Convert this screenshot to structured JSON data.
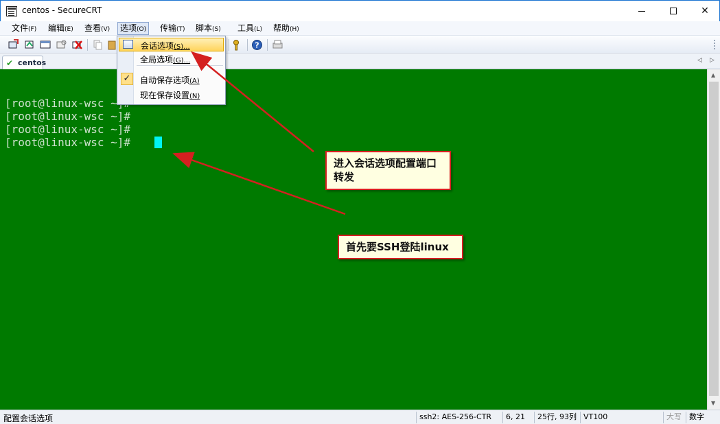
{
  "window": {
    "title": "centos - SecureCRT"
  },
  "menu": [
    {
      "label": "文件",
      "acc": "(F)"
    },
    {
      "label": "编辑",
      "acc": "(E)"
    },
    {
      "label": "查看",
      "acc": "(V)"
    },
    {
      "label": "选项",
      "acc": "(O)"
    },
    {
      "label": "传输",
      "acc": "(T)"
    },
    {
      "label": "脚本",
      "acc": "(S)"
    },
    {
      "label": "工具",
      "acc": "(L)"
    },
    {
      "label": "帮助",
      "acc": "(H)"
    }
  ],
  "dropdown": {
    "items": [
      {
        "label": "会话选项",
        "acc": "(S)...",
        "highlighted": true
      },
      {
        "label": "全局选项",
        "acc": "(G)..."
      },
      {
        "label": "自动保存选项",
        "acc": "(A)",
        "checked": true
      },
      {
        "label": "现在保存设置",
        "acc": "(N)"
      }
    ]
  },
  "tab": {
    "label": "centos"
  },
  "terminal": {
    "lines": [
      "[root@linux-wsc ~]#",
      "[root@linux-wsc ~]#",
      "[root@linux-wsc ~]#",
      "[root@linux-wsc ~]#"
    ],
    "background": "#007a00",
    "cursor_color": "#00f5f5"
  },
  "callouts": {
    "session_hint": "进入会话选项配置端口转发",
    "ssh_hint": "首先要SSH登陆linux"
  },
  "status": {
    "message": "配置会话选项",
    "cipher": "ssh2: AES-256-CTR",
    "position": "6, 21",
    "size": "25行, 93列",
    "emulation": "VT100",
    "caps": "大写",
    "num": "数字"
  },
  "colors": {
    "accent": "#d42020",
    "callout_bg": "#ffffe1"
  }
}
